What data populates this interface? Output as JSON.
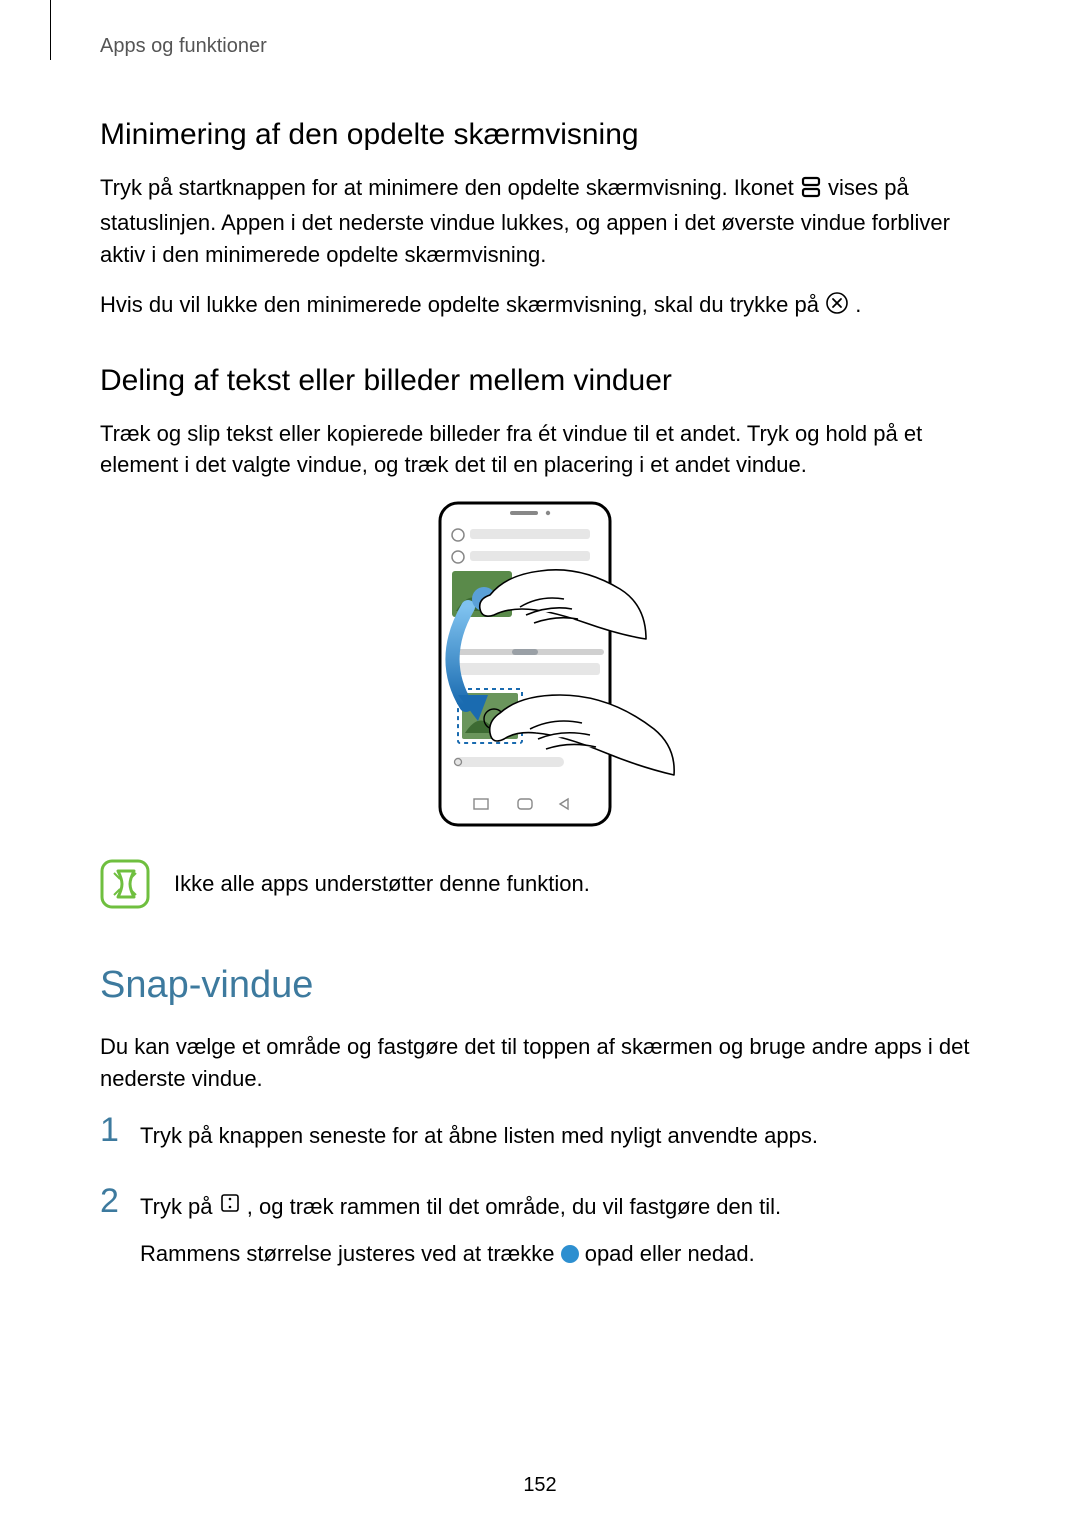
{
  "breadcrumb": "Apps og funktioner",
  "section1": {
    "heading": "Minimering af den opdelte skærmvisning",
    "p1_a": "Tryk på startknappen for at minimere den opdelte skærmvisning. Ikonet ",
    "p1_b": " vises på statuslinjen. Appen i det nederste vindue lukkes, og appen i det øverste vindue forbliver aktiv i den minimerede opdelte skærmvisning.",
    "p2_a": "Hvis du vil lukke den minimerede opdelte skærmvisning, skal du trykke på ",
    "p2_b": "."
  },
  "section2": {
    "heading": "Deling af tekst eller billeder mellem vinduer",
    "p1": "Træk og slip tekst eller kopierede billeder fra ét vindue til et andet. Tryk og hold på et element i det valgte vindue, og træk det til en placering i et andet vindue."
  },
  "note": {
    "text": "Ikke alle apps understøtter denne funktion."
  },
  "section3": {
    "heading": "Snap-vindue",
    "intro": "Du kan vælge et område og fastgøre det til toppen af skærmen og bruge andre apps i det nederste vindue.",
    "step1": "Tryk på knappen seneste for at åbne listen med nyligt anvendte apps.",
    "step2a": "Tryk på ",
    "step2b": ", og træk rammen til det område, du vil fastgøre den til.",
    "step2c_a": "Rammens størrelse justeres ved at trække ",
    "step2c_b": " opad eller nedad."
  },
  "page_number": "152"
}
